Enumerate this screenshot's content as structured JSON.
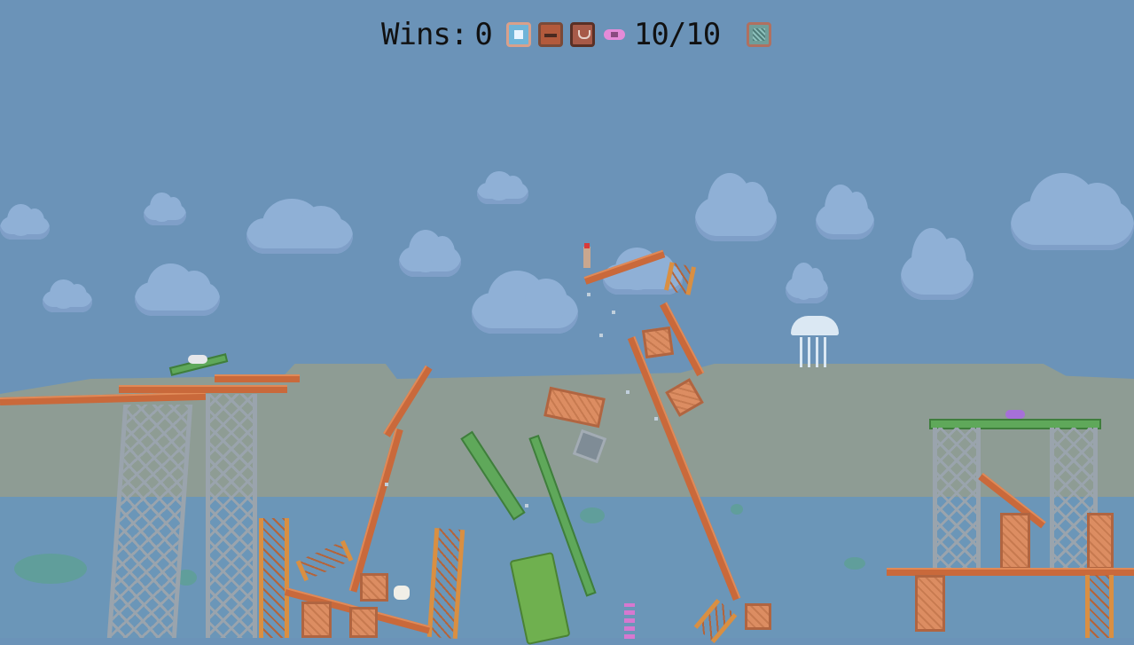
{
  "hud": {
    "wins_label": "Wins:",
    "wins_value": "0",
    "flower_count": "10/10",
    "icons": [
      "party-icon",
      "build-icon",
      "face-icon",
      "flower-icon",
      "settings-icon"
    ]
  },
  "colors": {
    "sky": "#6b93b8",
    "cloud": "#8fb0d6",
    "hills": "#8e9c94",
    "water": "#6b96b8",
    "wood": "#c9693b",
    "crate": "#dc8d62",
    "green_beam": "#5fa85a",
    "steel": "#9aa4ad",
    "hud_text": "#111111"
  }
}
